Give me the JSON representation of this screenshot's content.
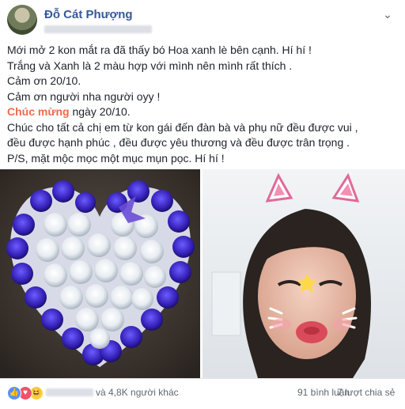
{
  "post": {
    "author": "Đỗ Cát Phượng",
    "lines": [
      "Mới mở 2 kon mắt ra đã thấy bó Hoa xanh lè bên cạnh. Hí hí !",
      "Trắng và Xanh là 2 màu hợp với mình nên mình rất thích .",
      "Cảm ơn 20/10.",
      "Cảm ơn người nha người oyy !"
    ],
    "hashtag": "Chúc mừng",
    "hashtag_rest": " ngày 20/10.",
    "lines_after": [
      "Chúc cho tất cả chị em từ kon gái đến đàn bà và phụ nữ đều được vui ,",
      "đều được hạnh phúc , đều được yêu thương và đều được trân trọng .",
      "P/S, mặt mộc mọc một mục mụn pọc. Hí hí !"
    ]
  },
  "footer": {
    "reaction_icons": [
      "like-icon",
      "love-icon",
      "haha-icon"
    ],
    "others_text": "và 4,8K người khác",
    "comments_text": "91 bình luận",
    "shares_text": "7 lượt chia sẻ"
  },
  "colors": {
    "author_link": "#365899",
    "hashtag": "#ed6b4a",
    "secondary_text": "#606770"
  }
}
